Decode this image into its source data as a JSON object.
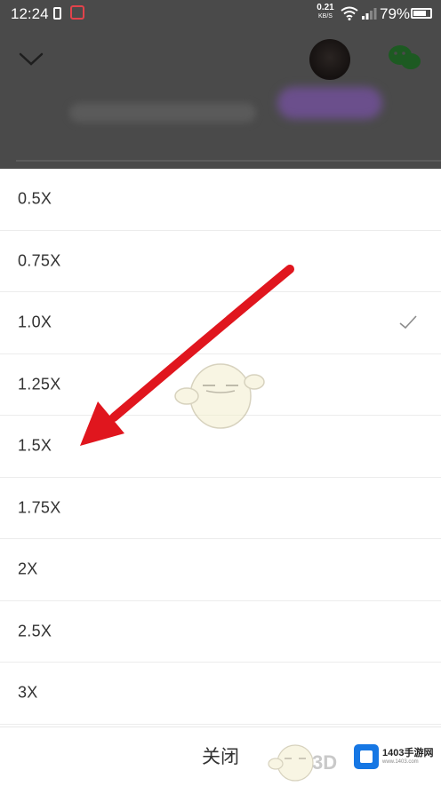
{
  "status_bar": {
    "time": "12:24",
    "net_speed_value": "0.21",
    "net_speed_unit": "KB/S",
    "battery": "79%",
    "icons": [
      "vibrate-icon",
      "app-notification-icon",
      "wifi-icon",
      "signal-icon",
      "battery-icon"
    ]
  },
  "player_header": {
    "collapse_icon": "chevron-down-icon",
    "share_icon": "wechat-icon"
  },
  "speed_menu": {
    "options": [
      {
        "label": "0.5X",
        "selected": false
      },
      {
        "label": "0.75X",
        "selected": false
      },
      {
        "label": "1.0X",
        "selected": true
      },
      {
        "label": "1.25X",
        "selected": false
      },
      {
        "label": "1.5X",
        "selected": false
      },
      {
        "label": "1.75X",
        "selected": false
      },
      {
        "label": "2X",
        "selected": false
      },
      {
        "label": "2.5X",
        "selected": false
      },
      {
        "label": "3X",
        "selected": false
      }
    ],
    "check_icon": "checkmark-icon",
    "close_label": "关闭"
  },
  "overlays": {
    "annotation_arrow_color": "#e0161e",
    "watermark_3d": "3D",
    "site_name": "1403手游网",
    "site_domain": "www.1403.com"
  },
  "colors": {
    "dim_background": "#4a4a4a",
    "sheet_background": "#ffffff",
    "text": "#333333",
    "divider": "#ececec"
  }
}
